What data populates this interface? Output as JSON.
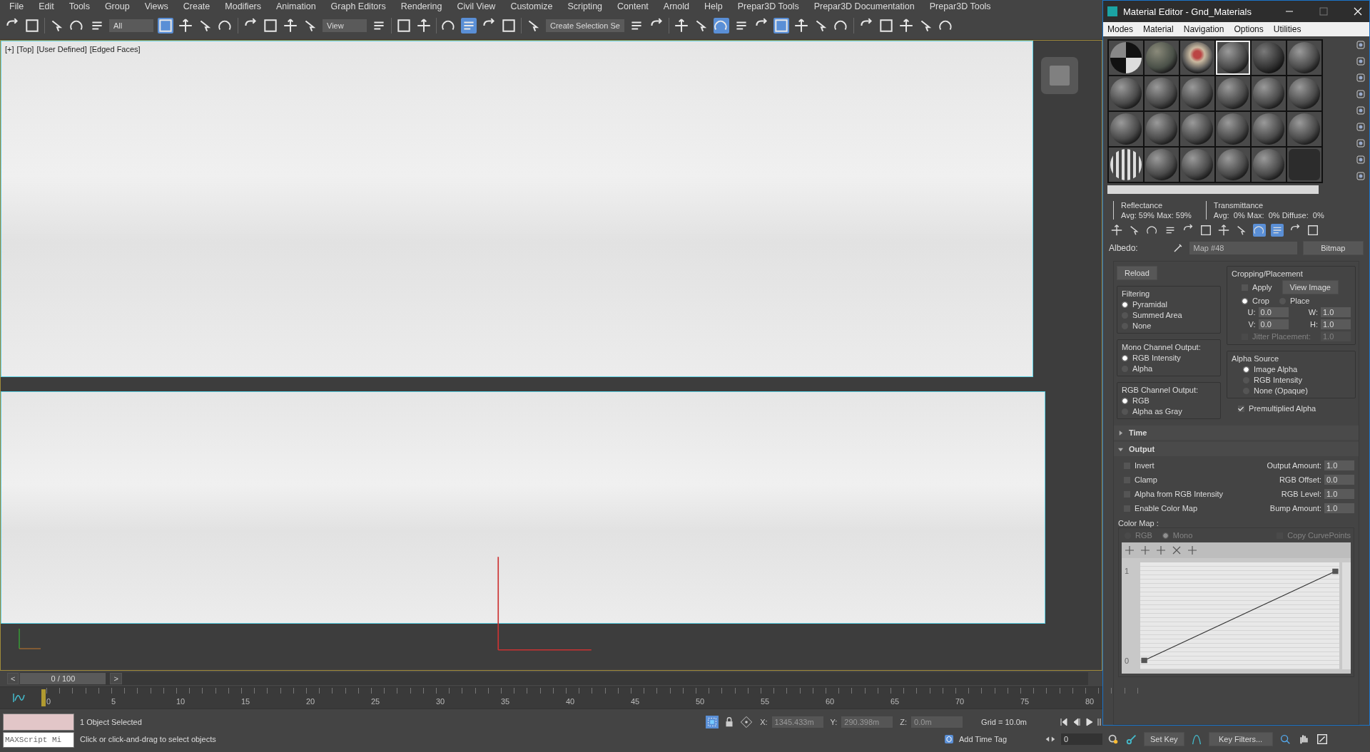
{
  "menu": [
    "File",
    "Edit",
    "Tools",
    "Group",
    "Views",
    "Create",
    "Modifiers",
    "Animation",
    "Graph Editors",
    "Rendering",
    "Civil View",
    "Customize",
    "Scripting",
    "Content",
    "Arnold",
    "Help",
    "Prepar3D Tools",
    "Prepar3D Documentation",
    "Prepar3D Tools"
  ],
  "toolbar": [
    {
      "kind": "button",
      "selected": false
    },
    {
      "kind": "button",
      "selected": false
    },
    {
      "kind": "sep"
    },
    {
      "kind": "button",
      "selected": false
    },
    {
      "kind": "button",
      "selected": false
    },
    {
      "kind": "button",
      "selected": false
    },
    {
      "kind": "dropdown",
      "value": "All"
    },
    {
      "kind": "button",
      "selected": true
    },
    {
      "kind": "button",
      "selected": false
    },
    {
      "kind": "button",
      "selected": false
    },
    {
      "kind": "button",
      "selected": false
    },
    {
      "kind": "sep"
    },
    {
      "kind": "button",
      "selected": false
    },
    {
      "kind": "button",
      "selected": false
    },
    {
      "kind": "button",
      "selected": false
    },
    {
      "kind": "button",
      "selected": false
    },
    {
      "kind": "dropdown",
      "value": "View"
    },
    {
      "kind": "button",
      "selected": false
    },
    {
      "kind": "sep"
    },
    {
      "kind": "button",
      "selected": false
    },
    {
      "kind": "button",
      "selected": false
    },
    {
      "kind": "sep"
    },
    {
      "kind": "button",
      "selected": false
    },
    {
      "kind": "button",
      "selected": true
    },
    {
      "kind": "button",
      "selected": false
    },
    {
      "kind": "button",
      "selected": false
    },
    {
      "kind": "sep"
    },
    {
      "kind": "button",
      "selected": false
    },
    {
      "kind": "dropdown",
      "value": "Create Selection Se"
    },
    {
      "kind": "button",
      "selected": false
    },
    {
      "kind": "button",
      "selected": false
    },
    {
      "kind": "sep"
    },
    {
      "kind": "button",
      "selected": false
    },
    {
      "kind": "button",
      "selected": false
    },
    {
      "kind": "button",
      "selected": true
    },
    {
      "kind": "button",
      "selected": false
    },
    {
      "kind": "button",
      "selected": false
    },
    {
      "kind": "button",
      "selected": true
    },
    {
      "kind": "button",
      "selected": false
    },
    {
      "kind": "button",
      "selected": false
    },
    {
      "kind": "button",
      "selected": false
    },
    {
      "kind": "sep"
    },
    {
      "kind": "button",
      "selected": false
    },
    {
      "kind": "button",
      "selected": false
    },
    {
      "kind": "button",
      "selected": false
    },
    {
      "kind": "button",
      "selected": false
    },
    {
      "kind": "button",
      "selected": false
    }
  ],
  "viewport": {
    "labels": [
      "[+]",
      "[Top]",
      "[User Defined]",
      "[Edged Faces]"
    ]
  },
  "time_slider": {
    "prev": "<",
    "label": "0 / 100",
    "next": ">",
    "level": 0
  },
  "timeline": {
    "ticks": [
      "0",
      "5",
      "10",
      "15",
      "20",
      "25",
      "30",
      "35",
      "40",
      "45",
      "50",
      "55",
      "60",
      "65",
      "70",
      "75",
      "80"
    ]
  },
  "status": {
    "listener": "MAXScript Mi",
    "selection": "1 Object Selected",
    "prompt": "Click or click-and-drag to select objects",
    "coords": [
      {
        "axis": "X:",
        "value": "1345.433m"
      },
      {
        "axis": "Y:",
        "value": "290.398m"
      },
      {
        "axis": "Z:",
        "value": "0.0m"
      }
    ],
    "grid": "Grid = 10.0m",
    "time_tag": "Add Time Tag",
    "frame": "0"
  },
  "keys": {
    "set_key": "Set Key",
    "key_filters": "Key Filters..."
  },
  "material_editor": {
    "title": "Material Editor - Gnd_Materials",
    "menu": [
      "Modes",
      "Material",
      "Navigation",
      "Options",
      "Utilities"
    ],
    "slots": [
      {
        "kind": "checker",
        "selected": false
      },
      {
        "kind": "mixed",
        "selected": false
      },
      {
        "kind": "textured",
        "selected": false
      },
      {
        "kind": "gray",
        "selected": true
      },
      {
        "kind": "dark",
        "selected": false
      },
      {
        "kind": "gray",
        "selected": false
      },
      {
        "kind": "gray",
        "selected": false
      },
      {
        "kind": "gray",
        "selected": false
      },
      {
        "kind": "gray",
        "selected": false
      },
      {
        "kind": "gray",
        "selected": false
      },
      {
        "kind": "gray",
        "selected": false
      },
      {
        "kind": "gray",
        "selected": false
      },
      {
        "kind": "gray",
        "selected": false
      },
      {
        "kind": "gray",
        "selected": false
      },
      {
        "kind": "gray",
        "selected": false
      },
      {
        "kind": "gray",
        "selected": false
      },
      {
        "kind": "gray",
        "selected": false
      },
      {
        "kind": "gray",
        "selected": false
      },
      {
        "kind": "striped",
        "selected": false
      },
      {
        "kind": "gray",
        "selected": false
      },
      {
        "kind": "gray",
        "selected": false
      },
      {
        "kind": "gray",
        "selected": false
      },
      {
        "kind": "gray",
        "selected": false
      },
      {
        "kind": "empty",
        "selected": false
      }
    ],
    "reflectance": {
      "title": "Reflectance",
      "values": "Avg: 59% Max: 59%"
    },
    "transmittance": {
      "title": "Transmittance",
      "values": "Avg:  0% Max:  0% Diffuse:  0%"
    },
    "tools": [
      {
        "selected": false
      },
      {
        "selected": false
      },
      {
        "selected": false
      },
      {
        "selected": false
      },
      {
        "selected": false
      },
      {
        "selected": false
      },
      {
        "selected": false
      },
      {
        "selected": false
      },
      {
        "selected": true
      },
      {
        "selected": true
      },
      {
        "selected": false
      },
      {
        "selected": false
      }
    ],
    "albedo": {
      "label": "Albedo:",
      "map": "Map #48",
      "type": "Bitmap"
    },
    "bitmap": {
      "reload": "Reload",
      "filtering": {
        "title": "Filtering",
        "options": [
          {
            "label": "Pyramidal",
            "selected": true
          },
          {
            "label": "Summed Area",
            "selected": false
          },
          {
            "label": "None",
            "selected": false
          }
        ]
      },
      "mono": {
        "title": "Mono Channel Output:",
        "options": [
          {
            "label": "RGB Intensity",
            "selected": true
          },
          {
            "label": "Alpha",
            "selected": false
          }
        ]
      },
      "rgb_out": {
        "title": "RGB Channel Output:",
        "options": [
          {
            "label": "RGB",
            "selected": true
          },
          {
            "label": "Alpha as Gray",
            "selected": false
          }
        ]
      },
      "cropping": {
        "title": "Cropping/Placement",
        "apply": {
          "label": "Apply",
          "checked": false
        },
        "view_image": "View Image",
        "modes": [
          {
            "label": "Crop",
            "selected": true
          },
          {
            "label": "Place",
            "selected": false
          }
        ],
        "spinners": [
          {
            "label": "U:",
            "value": "0.0"
          },
          {
            "label": "W:",
            "value": "1.0"
          },
          {
            "label": "V:",
            "value": "0.0"
          },
          {
            "label": "H:",
            "value": "1.0"
          }
        ],
        "jitter": {
          "label": "Jitter Placement:",
          "value": "1.0",
          "checked": false,
          "disabled": true
        }
      },
      "alpha_source": {
        "title": "Alpha Source",
        "options": [
          {
            "label": "Image Alpha",
            "selected": true
          },
          {
            "label": "RGB Intensity",
            "selected": false
          },
          {
            "label": "None (Opaque)",
            "selected": false
          }
        ]
      },
      "premultiplied": {
        "label": "Premultiplied Alpha",
        "checked": true
      }
    },
    "rollouts": [
      {
        "title": "Time",
        "expanded": false
      },
      {
        "title": "Output",
        "expanded": true
      }
    ],
    "output": {
      "checkboxes": [
        {
          "label": "Invert",
          "checked": false
        },
        {
          "label": "Clamp",
          "checked": false
        },
        {
          "label": "Alpha from RGB Intensity",
          "checked": false
        },
        {
          "label": "Enable Color Map",
          "checked": false
        }
      ],
      "spinners": [
        {
          "label": "Output Amount:",
          "value": "1.0"
        },
        {
          "label": "RGB Offset:",
          "value": "0.0"
        },
        {
          "label": "RGB Level:",
          "value": "1.0"
        },
        {
          "label": "Bump Amount:",
          "value": "1.0"
        }
      ],
      "color_map": {
        "title": "Color Map :",
        "disabled": true,
        "modes": [
          {
            "label": "RGB",
            "selected": false
          },
          {
            "label": "Mono",
            "selected": true
          }
        ],
        "copy_points": {
          "label": "Copy CurvePoints",
          "checked": false
        },
        "axis_labels": [
          "1",
          "0"
        ]
      }
    }
  }
}
